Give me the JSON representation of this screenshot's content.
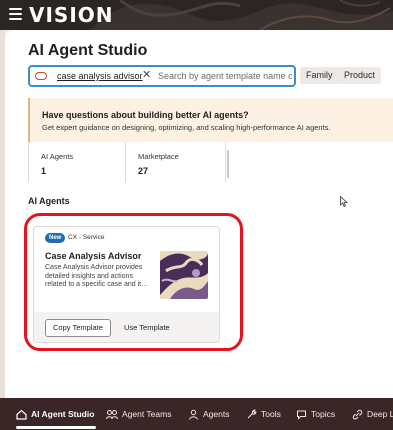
{
  "header": {
    "brand": "VISION"
  },
  "page": {
    "title": "AI Agent Studio"
  },
  "search": {
    "chip_label": "case analysis advisor",
    "placeholder": "Search by agent template name or c"
  },
  "filters": [
    "Family",
    "Product"
  ],
  "banner": {
    "title": "Have questions about building better AI agents?",
    "subtitle": "Get expert guidance on designing, optimizing, and scaling high-performance AI agents."
  },
  "stats": [
    {
      "label": "AI Agents",
      "value": "1"
    },
    {
      "label": "Marketplace",
      "value": "27"
    }
  ],
  "section_title": "AI Agents",
  "card": {
    "badge": "New",
    "category": "CX - Service",
    "title": "Case Analysis Advisor",
    "description": "Case Analysis Advisor provides detailed insights and actions related to a specific case and it…",
    "copy_label": "Copy Template",
    "use_label": "Use Template"
  },
  "bottom_nav": [
    {
      "label": "AI Agent Studio",
      "icon": "home-icon",
      "active": true
    },
    {
      "label": "Agent Teams",
      "icon": "agent-teams-icon",
      "active": false
    },
    {
      "label": "Agents",
      "icon": "agents-icon",
      "active": false
    },
    {
      "label": "Tools",
      "icon": "tools-icon",
      "active": false
    },
    {
      "label": "Topics",
      "icon": "topics-icon",
      "active": false
    },
    {
      "label": "Deep L",
      "icon": "deep-link-icon",
      "active": false
    }
  ],
  "colors": {
    "header_bg": "#2b2624",
    "accent_blue": "#3b8fc9",
    "highlight_red": "#e3141b",
    "banner_bg": "#fcf1e2",
    "bottom_nav_bg": "#3a2527",
    "new_badge": "#1f6eb5"
  }
}
